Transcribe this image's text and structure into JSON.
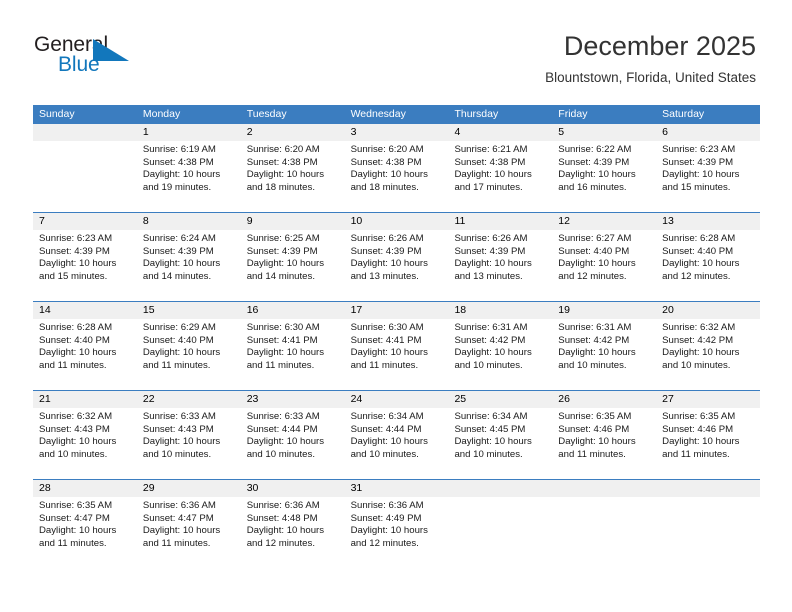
{
  "brand": {
    "name_part1": "General",
    "name_part2": "Blue",
    "accent_color": "#1277bc",
    "logo_mark": "triangle-flag-icon"
  },
  "header": {
    "title": "December 2025",
    "subtitle": "Blountstown, Florida, United States"
  },
  "theme": {
    "header_row_bg": "#3b7dc0",
    "date_band_bg": "#f0f0f0",
    "cell_bg": "#ffffff",
    "text_color": "#1a1a1a"
  },
  "weekdays": [
    "Sunday",
    "Monday",
    "Tuesday",
    "Wednesday",
    "Thursday",
    "Friday",
    "Saturday"
  ],
  "weeks": [
    {
      "days": [
        {
          "date": "",
          "sunrise": "",
          "sunset": "",
          "daylight_line1": "",
          "daylight_line2": ""
        },
        {
          "date": "1",
          "sunrise": "Sunrise: 6:19 AM",
          "sunset": "Sunset: 4:38 PM",
          "daylight_line1": "Daylight: 10 hours",
          "daylight_line2": "and 19 minutes."
        },
        {
          "date": "2",
          "sunrise": "Sunrise: 6:20 AM",
          "sunset": "Sunset: 4:38 PM",
          "daylight_line1": "Daylight: 10 hours",
          "daylight_line2": "and 18 minutes."
        },
        {
          "date": "3",
          "sunrise": "Sunrise: 6:20 AM",
          "sunset": "Sunset: 4:38 PM",
          "daylight_line1": "Daylight: 10 hours",
          "daylight_line2": "and 18 minutes."
        },
        {
          "date": "4",
          "sunrise": "Sunrise: 6:21 AM",
          "sunset": "Sunset: 4:38 PM",
          "daylight_line1": "Daylight: 10 hours",
          "daylight_line2": "and 17 minutes."
        },
        {
          "date": "5",
          "sunrise": "Sunrise: 6:22 AM",
          "sunset": "Sunset: 4:39 PM",
          "daylight_line1": "Daylight: 10 hours",
          "daylight_line2": "and 16 minutes."
        },
        {
          "date": "6",
          "sunrise": "Sunrise: 6:23 AM",
          "sunset": "Sunset: 4:39 PM",
          "daylight_line1": "Daylight: 10 hours",
          "daylight_line2": "and 15 minutes."
        }
      ]
    },
    {
      "days": [
        {
          "date": "7",
          "sunrise": "Sunrise: 6:23 AM",
          "sunset": "Sunset: 4:39 PM",
          "daylight_line1": "Daylight: 10 hours",
          "daylight_line2": "and 15 minutes."
        },
        {
          "date": "8",
          "sunrise": "Sunrise: 6:24 AM",
          "sunset": "Sunset: 4:39 PM",
          "daylight_line1": "Daylight: 10 hours",
          "daylight_line2": "and 14 minutes."
        },
        {
          "date": "9",
          "sunrise": "Sunrise: 6:25 AM",
          "sunset": "Sunset: 4:39 PM",
          "daylight_line1": "Daylight: 10 hours",
          "daylight_line2": "and 14 minutes."
        },
        {
          "date": "10",
          "sunrise": "Sunrise: 6:26 AM",
          "sunset": "Sunset: 4:39 PM",
          "daylight_line1": "Daylight: 10 hours",
          "daylight_line2": "and 13 minutes."
        },
        {
          "date": "11",
          "sunrise": "Sunrise: 6:26 AM",
          "sunset": "Sunset: 4:39 PM",
          "daylight_line1": "Daylight: 10 hours",
          "daylight_line2": "and 13 minutes."
        },
        {
          "date": "12",
          "sunrise": "Sunrise: 6:27 AM",
          "sunset": "Sunset: 4:40 PM",
          "daylight_line1": "Daylight: 10 hours",
          "daylight_line2": "and 12 minutes."
        },
        {
          "date": "13",
          "sunrise": "Sunrise: 6:28 AM",
          "sunset": "Sunset: 4:40 PM",
          "daylight_line1": "Daylight: 10 hours",
          "daylight_line2": "and 12 minutes."
        }
      ]
    },
    {
      "days": [
        {
          "date": "14",
          "sunrise": "Sunrise: 6:28 AM",
          "sunset": "Sunset: 4:40 PM",
          "daylight_line1": "Daylight: 10 hours",
          "daylight_line2": "and 11 minutes."
        },
        {
          "date": "15",
          "sunrise": "Sunrise: 6:29 AM",
          "sunset": "Sunset: 4:40 PM",
          "daylight_line1": "Daylight: 10 hours",
          "daylight_line2": "and 11 minutes."
        },
        {
          "date": "16",
          "sunrise": "Sunrise: 6:30 AM",
          "sunset": "Sunset: 4:41 PM",
          "daylight_line1": "Daylight: 10 hours",
          "daylight_line2": "and 11 minutes."
        },
        {
          "date": "17",
          "sunrise": "Sunrise: 6:30 AM",
          "sunset": "Sunset: 4:41 PM",
          "daylight_line1": "Daylight: 10 hours",
          "daylight_line2": "and 11 minutes."
        },
        {
          "date": "18",
          "sunrise": "Sunrise: 6:31 AM",
          "sunset": "Sunset: 4:42 PM",
          "daylight_line1": "Daylight: 10 hours",
          "daylight_line2": "and 10 minutes."
        },
        {
          "date": "19",
          "sunrise": "Sunrise: 6:31 AM",
          "sunset": "Sunset: 4:42 PM",
          "daylight_line1": "Daylight: 10 hours",
          "daylight_line2": "and 10 minutes."
        },
        {
          "date": "20",
          "sunrise": "Sunrise: 6:32 AM",
          "sunset": "Sunset: 4:42 PM",
          "daylight_line1": "Daylight: 10 hours",
          "daylight_line2": "and 10 minutes."
        }
      ]
    },
    {
      "days": [
        {
          "date": "21",
          "sunrise": "Sunrise: 6:32 AM",
          "sunset": "Sunset: 4:43 PM",
          "daylight_line1": "Daylight: 10 hours",
          "daylight_line2": "and 10 minutes."
        },
        {
          "date": "22",
          "sunrise": "Sunrise: 6:33 AM",
          "sunset": "Sunset: 4:43 PM",
          "daylight_line1": "Daylight: 10 hours",
          "daylight_line2": "and 10 minutes."
        },
        {
          "date": "23",
          "sunrise": "Sunrise: 6:33 AM",
          "sunset": "Sunset: 4:44 PM",
          "daylight_line1": "Daylight: 10 hours",
          "daylight_line2": "and 10 minutes."
        },
        {
          "date": "24",
          "sunrise": "Sunrise: 6:34 AM",
          "sunset": "Sunset: 4:44 PM",
          "daylight_line1": "Daylight: 10 hours",
          "daylight_line2": "and 10 minutes."
        },
        {
          "date": "25",
          "sunrise": "Sunrise: 6:34 AM",
          "sunset": "Sunset: 4:45 PM",
          "daylight_line1": "Daylight: 10 hours",
          "daylight_line2": "and 10 minutes."
        },
        {
          "date": "26",
          "sunrise": "Sunrise: 6:35 AM",
          "sunset": "Sunset: 4:46 PM",
          "daylight_line1": "Daylight: 10 hours",
          "daylight_line2": "and 11 minutes."
        },
        {
          "date": "27",
          "sunrise": "Sunrise: 6:35 AM",
          "sunset": "Sunset: 4:46 PM",
          "daylight_line1": "Daylight: 10 hours",
          "daylight_line2": "and 11 minutes."
        }
      ]
    },
    {
      "days": [
        {
          "date": "28",
          "sunrise": "Sunrise: 6:35 AM",
          "sunset": "Sunset: 4:47 PM",
          "daylight_line1": "Daylight: 10 hours",
          "daylight_line2": "and 11 minutes."
        },
        {
          "date": "29",
          "sunrise": "Sunrise: 6:36 AM",
          "sunset": "Sunset: 4:47 PM",
          "daylight_line1": "Daylight: 10 hours",
          "daylight_line2": "and 11 minutes."
        },
        {
          "date": "30",
          "sunrise": "Sunrise: 6:36 AM",
          "sunset": "Sunset: 4:48 PM",
          "daylight_line1": "Daylight: 10 hours",
          "daylight_line2": "and 12 minutes."
        },
        {
          "date": "31",
          "sunrise": "Sunrise: 6:36 AM",
          "sunset": "Sunset: 4:49 PM",
          "daylight_line1": "Daylight: 10 hours",
          "daylight_line2": "and 12 minutes."
        },
        {
          "date": "",
          "sunrise": "",
          "sunset": "",
          "daylight_line1": "",
          "daylight_line2": ""
        },
        {
          "date": "",
          "sunrise": "",
          "sunset": "",
          "daylight_line1": "",
          "daylight_line2": ""
        },
        {
          "date": "",
          "sunrise": "",
          "sunset": "",
          "daylight_line1": "",
          "daylight_line2": ""
        }
      ]
    }
  ]
}
